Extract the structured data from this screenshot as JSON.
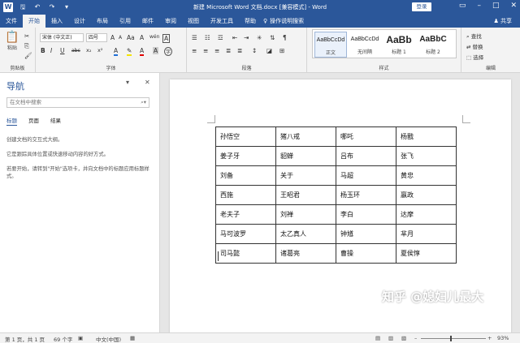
{
  "titlebar": {
    "title": "新建 Microsoft Word 文档.docx [兼容模式] - Word",
    "login_label": "登录",
    "icons": [
      "word-icon",
      "save-icon",
      "undo-icon",
      "redo-icon",
      "customize-icon"
    ],
    "window_controls": [
      "ribbon-display-icon",
      "minimize-icon",
      "maximize-icon",
      "close-icon"
    ]
  },
  "tabs": [
    "文件",
    "开始",
    "插入",
    "设计",
    "布局",
    "引用",
    "邮件",
    "审阅",
    "视图",
    "开发工具",
    "帮助"
  ],
  "active_tab": "开始",
  "tell_me": "操作说明搜索",
  "share_label": "共享",
  "ribbon": {
    "clipboard": {
      "paste": "粘贴",
      "label": "剪贴板"
    },
    "font": {
      "name": "宋体 (中文正)",
      "size": "四号",
      "label": "字体",
      "grow": "A",
      "shrink": "A",
      "aa": "Aa",
      "clear": "A",
      "wen": "wén",
      "border": "A",
      "bold": "B",
      "italic": "I",
      "underline": "U",
      "strike": "abc",
      "sub": "x₂",
      "sup": "x²",
      "highlight": "A",
      "color": "A",
      "shade": "A",
      "enclose": "字"
    },
    "paragraph": {
      "label": "段落"
    },
    "styles": {
      "label": "样式",
      "items": [
        {
          "sample": "AaBbCcDd",
          "name": "正文"
        },
        {
          "sample": "AaBbCcDd",
          "name": "无间隔"
        },
        {
          "sample": "AaBb",
          "name": "标题 1"
        },
        {
          "sample": "AaBbC",
          "name": "标题 2"
        }
      ]
    },
    "editing": {
      "find": "查找",
      "replace": "替换",
      "select": "选择",
      "label": "编辑"
    }
  },
  "nav": {
    "title": "导航",
    "search_placeholder": "在文档中搜索",
    "tabs": [
      "标题",
      "页面",
      "结果"
    ],
    "text1": "创建文档的交互式大纲。",
    "text2": "它是跟踪具体位置或快速移动内容的好方式。",
    "text3": "若要开始，请转到\"开始\"选项卡，并向文档中的标题应用标题样式。"
  },
  "table": [
    [
      "孙悟空",
      "猪八戒",
      "哪吒",
      "杨戬"
    ],
    [
      "姜子牙",
      "貂蝉",
      "吕布",
      "张飞"
    ],
    [
      "刘备",
      "关于",
      "马超",
      "黄忠"
    ],
    [
      "西施",
      "王昭君",
      "杨玉环",
      "嬴政"
    ],
    [
      "老夫子",
      "刘禅",
      "李白",
      "达摩"
    ],
    [
      "马可波罗",
      "太乙真人",
      "钟馗",
      "芈月"
    ],
    [
      "司马懿",
      "诸葛亮",
      "曹操",
      "夏侯惇"
    ]
  ],
  "status": {
    "page": "第 1 页，共 1 页",
    "words": "69 个字",
    "language": "中文(中国)",
    "zoom": "93%",
    "zoom_level": 0.465
  },
  "watermark": "知乎 @媳妇儿最大"
}
